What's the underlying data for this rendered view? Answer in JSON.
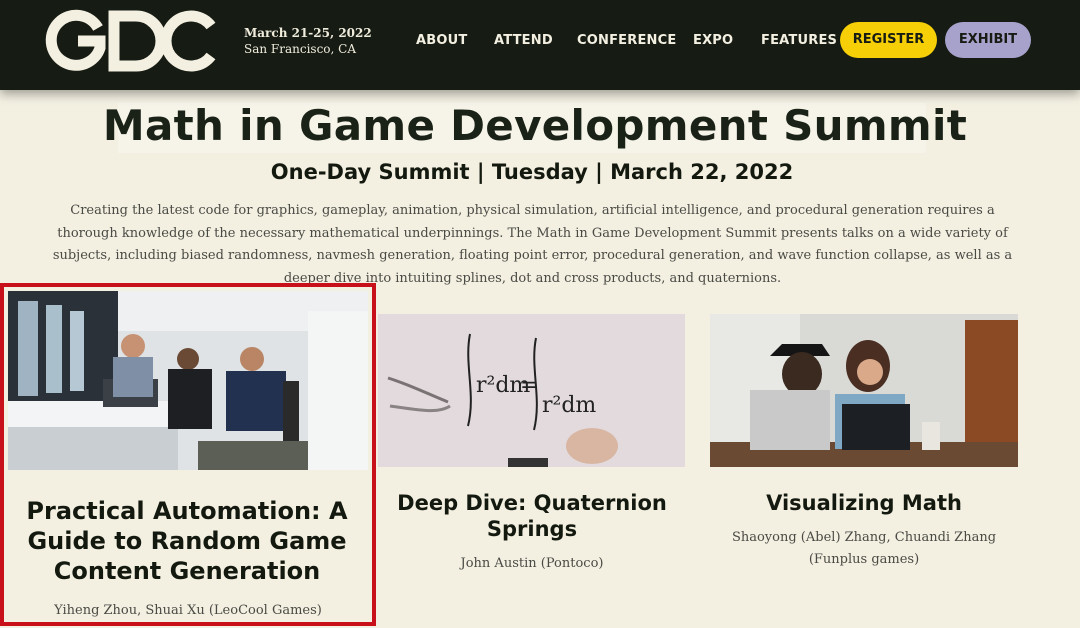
{
  "header": {
    "logo_text": "GDC",
    "event_date": "March 21-25, 2022",
    "event_location": "San Francisco, CA",
    "nav": [
      "ABOUT",
      "ATTEND",
      "CONFERENCE",
      "EXPO",
      "FEATURES"
    ],
    "register_label": "REGISTER",
    "exhibit_label": "EXHIBIT",
    "colors": {
      "bar": "#161b13",
      "register": "#f6cf07",
      "exhibit": "#a7a2cb"
    }
  },
  "intro": {
    "title": "Math in Game Development Summit",
    "subtitle": "One-Day Summit | Tuesday | March 22, 2022",
    "description": "Creating the latest code for graphics, gameplay, animation, physical simulation, artificial intelligence, and procedural generation requires a thorough knowledge of the necessary mathematical underpinnings. The Math in Game Development Summit presents talks on a wide variety of subjects, including biased randomness, navmesh generation, floating point error, procedural generation, and wave function collapse, as well as a deeper dive into intuiting splines, dot and cross products, and quaternions."
  },
  "talks": [
    {
      "title": "Practical Automation: A Guide to Random Game Content Generation",
      "speakers": "Yiheng Zhou, Shuai Xu (LeoCool Games)",
      "image": "office-team-photo",
      "highlighted": true
    },
    {
      "title": "Deep Dive: Quaternion Springs",
      "speakers": "John Austin (Pontoco)",
      "image": "whiteboard-math-photo",
      "highlighted": false
    },
    {
      "title": "Visualizing Math",
      "speakers": "Shaoyong (Abel) Zhang, Chuandi Zhang (Funplus games)",
      "image": "students-laptop-photo",
      "highlighted": false
    }
  ],
  "highlight_color": "#c8101a"
}
